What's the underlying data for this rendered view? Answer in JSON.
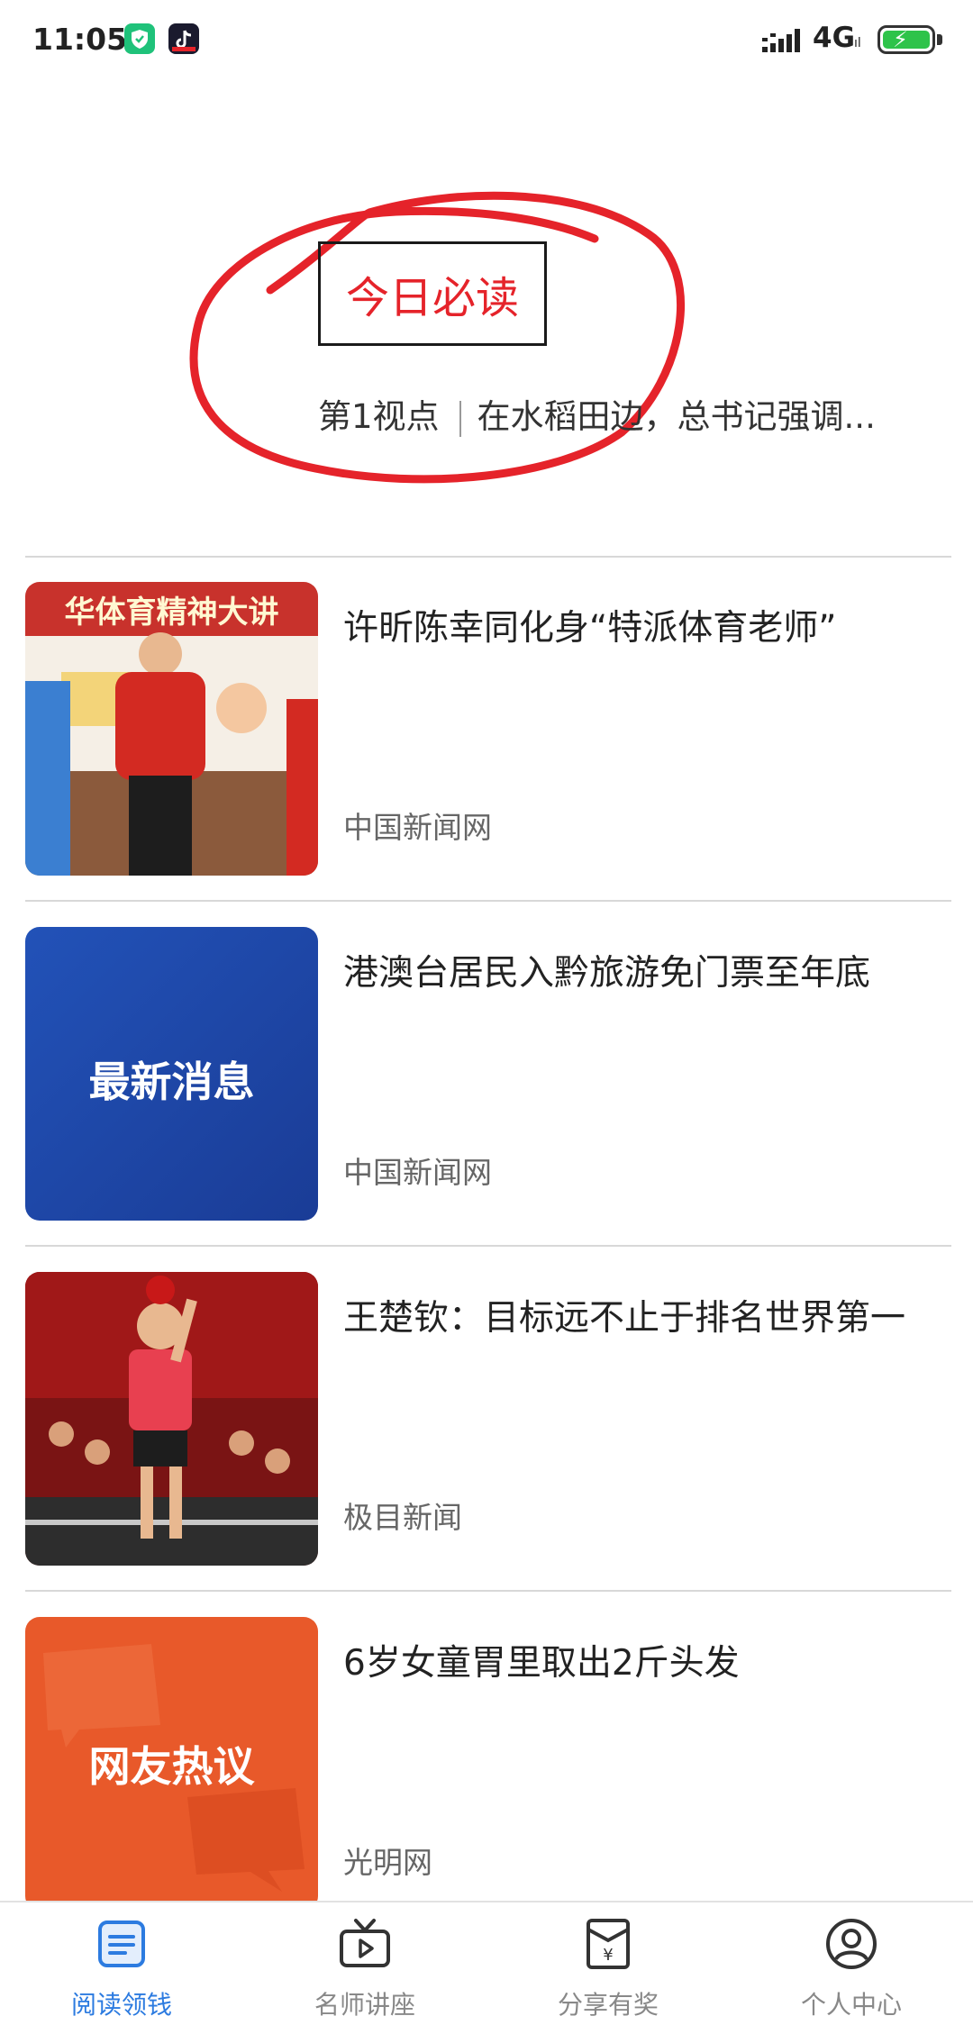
{
  "status_bar": {
    "time": "11:05",
    "network": "4G",
    "network_sub": "ıl",
    "battery_charging": true
  },
  "header": {
    "title": "今日必读",
    "subtitle_source": "第1视点",
    "subtitle_text": "在水稻田边，总书记强调..."
  },
  "articles": [
    {
      "title": "许昕陈幸同化身“特派体育老师”",
      "source": "中国新闻网",
      "thumb": "photo-table-tennis-event"
    },
    {
      "title": "港澳台居民入黔旅游免门票至年底",
      "source": "中国新闻网",
      "thumb_text": "最新消息"
    },
    {
      "title": "王楚钦：目标远不止于排名世界第一",
      "source": "极目新闻",
      "thumb": "photo-table-tennis-player"
    },
    {
      "title": "6岁女童胃里取出2斤头发",
      "source": "光明网",
      "thumb_text": "网友热议"
    }
  ],
  "thumb_banner_text": "华体育精神大讲",
  "bottom_nav": [
    {
      "label": "阅读领钱",
      "icon": "document-icon",
      "active": true
    },
    {
      "label": "名师讲座",
      "icon": "tv-icon",
      "active": false
    },
    {
      "label": "分享有奖",
      "icon": "red-envelope-icon",
      "active": false
    },
    {
      "label": "个人中心",
      "icon": "user-icon",
      "active": false
    }
  ],
  "colors": {
    "accent": "#2c7be0",
    "headline_red": "#e5232a",
    "annotation_red": "#e5232a",
    "news_blue": "#1e46a8",
    "hot_orange": "#e8592a"
  }
}
